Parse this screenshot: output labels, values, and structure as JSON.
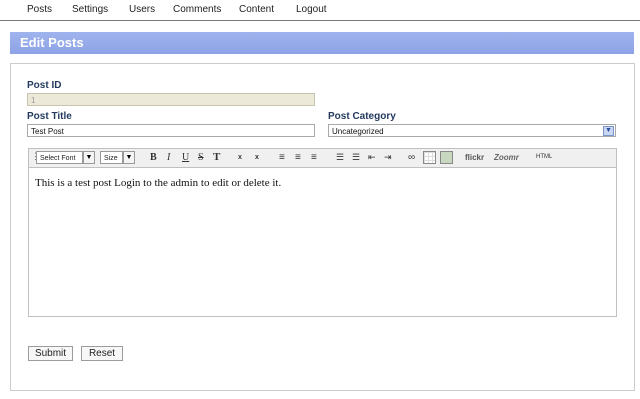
{
  "nav": {
    "items": [
      "Posts",
      "Settings",
      "Users",
      "Comments",
      "Content",
      "Logout"
    ]
  },
  "header": {
    "title": "Edit Posts"
  },
  "form": {
    "post_id_label": "Post ID",
    "post_id_value": "1",
    "post_title_label": "Post Title",
    "post_title_value": "Test Post",
    "post_category_label": "Post Category",
    "post_category_value": "Uncategorized"
  },
  "editor": {
    "font_select": "Select Font",
    "size_select": "Size",
    "toolbar": {
      "bold": "B",
      "italic": "I",
      "underline": "U",
      "strike": "S",
      "text_format": "T",
      "subscript": "x",
      "superscript": "x",
      "flickr": "flickr",
      "zoomr": "Zoomr",
      "html": "HTML"
    },
    "content": "This is a test post Login to the admin to edit or delete it."
  },
  "buttons": {
    "submit": "Submit",
    "reset": "Reset"
  },
  "colors": {
    "header_bg": "#9fb3ee",
    "label": "#233a5e",
    "readonly_bg": "#ece9d8"
  },
  "icons": [
    "chevron-down-icon",
    "link-icon",
    "table-icon",
    "image-icon",
    "align-left-icon",
    "align-center-icon",
    "align-right-icon",
    "bullet-list-icon",
    "numbered-list-icon",
    "outdent-icon",
    "indent-icon"
  ]
}
